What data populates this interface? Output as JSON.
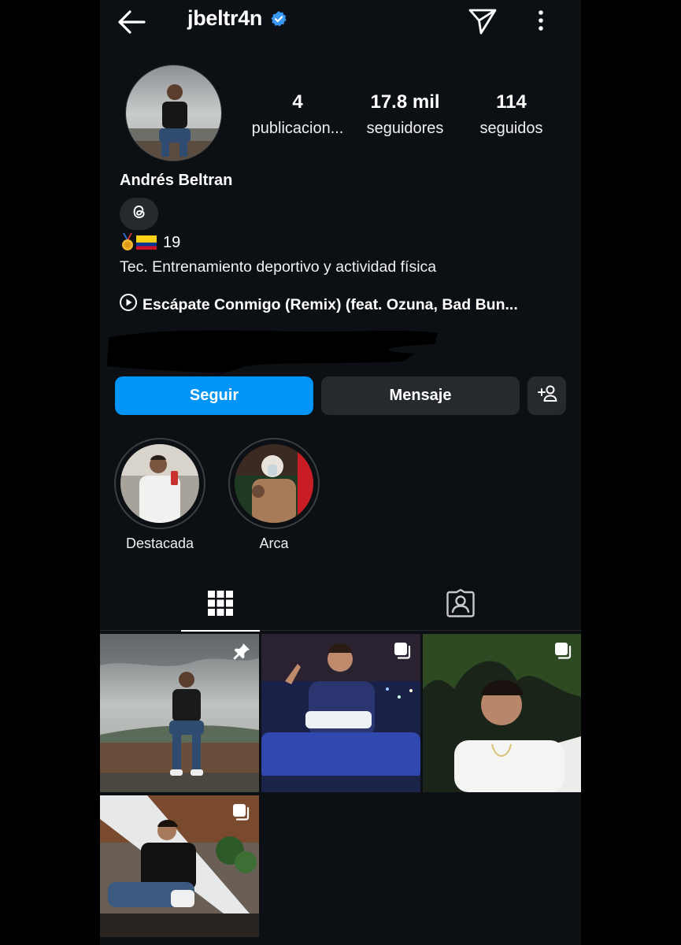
{
  "header": {
    "username": "jbeltr4n",
    "icons": {
      "back": "back-arrow-icon",
      "verified": "verified-badge-icon",
      "send": "send-icon",
      "more": "more-options-icon"
    }
  },
  "stats": [
    {
      "value": "4",
      "label": "publicacion..."
    },
    {
      "value": "17.8 mil",
      "label": "seguidores"
    },
    {
      "value": "114",
      "label": "seguidos"
    }
  ],
  "profile": {
    "full_name": "Andrés Beltran",
    "bio_line1_number": "19",
    "bio_line2": "Tec. Entrenamiento deportivo y actividad física",
    "music": "Escápate Conmigo (Remix) (feat. Ozuna, Bad Bun..."
  },
  "actions": {
    "follow": "Seguir",
    "message": "Mensaje"
  },
  "highlights": [
    {
      "label": "Destacada"
    },
    {
      "label": "Arca"
    }
  ],
  "tabs": {
    "posts_icon": "grid-icon",
    "tagged_icon": "tagged-user-icon"
  },
  "colors": {
    "background": "#0c1014",
    "accent": "#0095f6",
    "button": "#262a2e",
    "verified": "#3897f0"
  }
}
